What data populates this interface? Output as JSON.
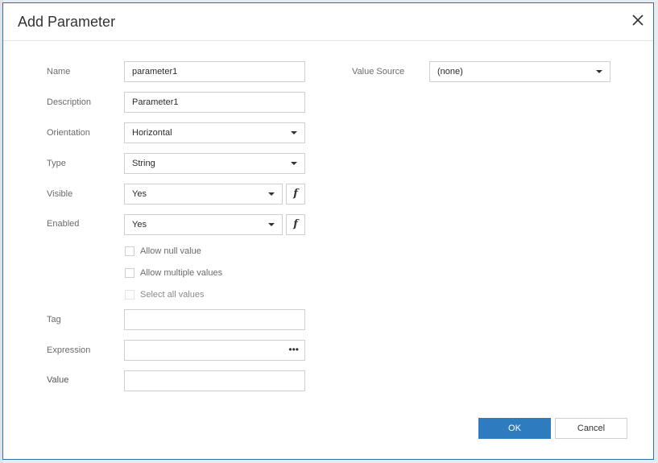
{
  "dialog": {
    "title": "Add Parameter",
    "close_icon": "close-icon"
  },
  "form": {
    "name": {
      "label": "Name",
      "value": "parameter1"
    },
    "description": {
      "label": "Description",
      "value": "Parameter1"
    },
    "orientation": {
      "label": "Orientation",
      "value": "Horizontal"
    },
    "type": {
      "label": "Type",
      "value": "String"
    },
    "visible": {
      "label": "Visible",
      "value": "Yes",
      "fx_icon": "function-icon"
    },
    "enabled": {
      "label": "Enabled",
      "value": "Yes",
      "fx_icon": "function-icon"
    },
    "allow_null": {
      "label": "Allow null value",
      "checked": false
    },
    "allow_multiple": {
      "label": "Allow multiple values",
      "checked": false
    },
    "select_all": {
      "label": "Select all values",
      "checked": false,
      "disabled": true
    },
    "tag": {
      "label": "Tag",
      "value": ""
    },
    "expression": {
      "label": "Expression",
      "value": "",
      "ellipsis": "•••"
    },
    "value": {
      "label": "Value",
      "value": ""
    },
    "value_source": {
      "label": "Value Source",
      "value": "(none)"
    }
  },
  "buttons": {
    "ok": "OK",
    "cancel": "Cancel"
  },
  "colors": {
    "accent": "#2f7bc0",
    "border": "#cfcfcf",
    "dialog_border": "#2f6fb3"
  }
}
